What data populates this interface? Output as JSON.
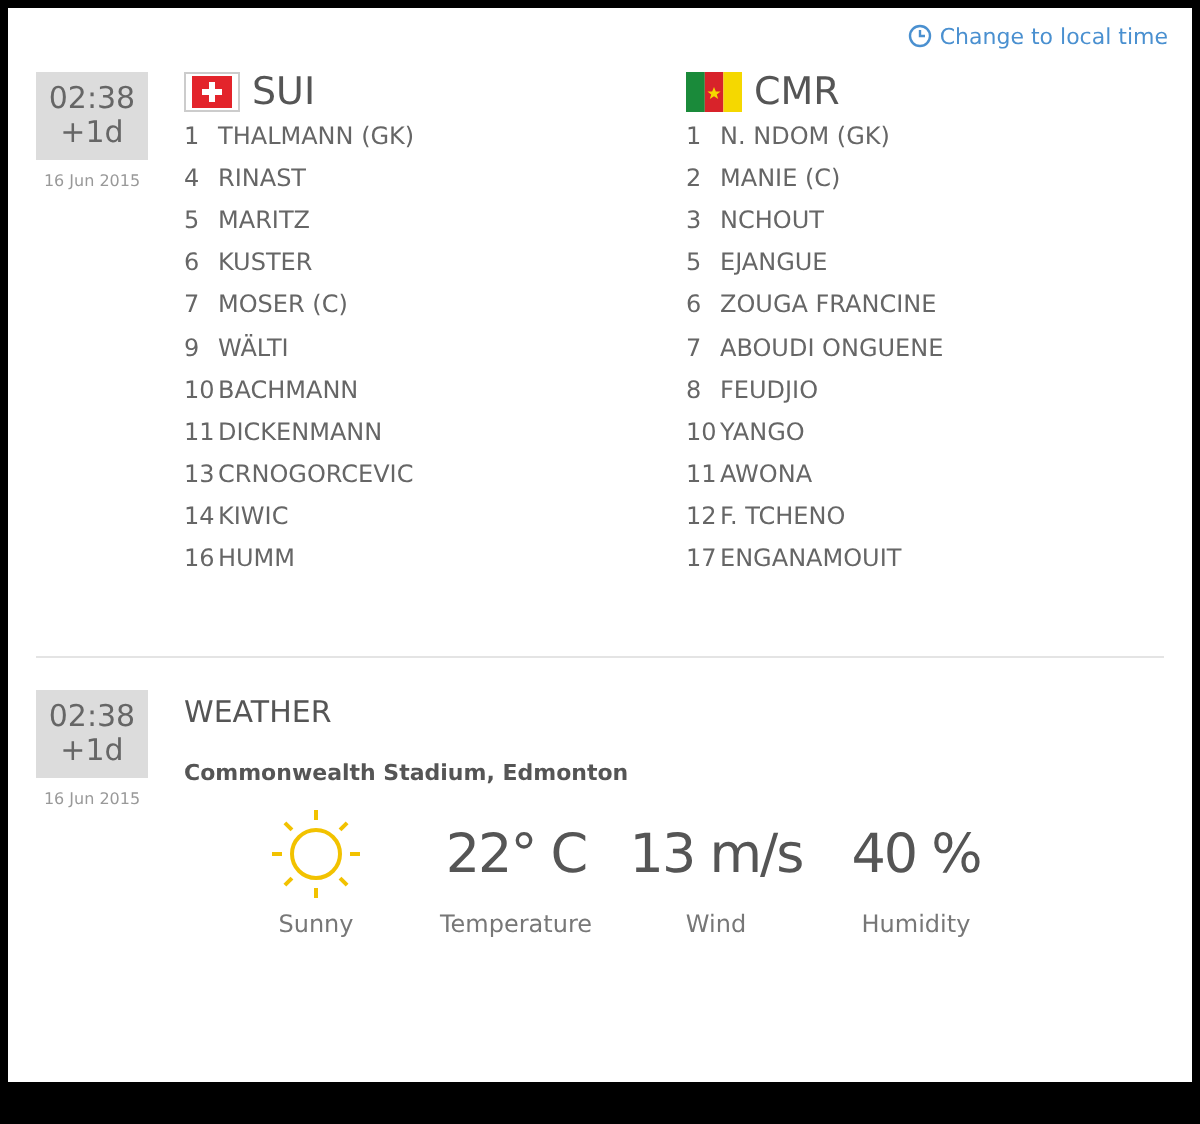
{
  "local_time_link": "Change to local time",
  "lineups": {
    "kickoff": {
      "time": "02:38",
      "day_offset": "+1d",
      "date": "16 Jun 2015"
    },
    "teams": [
      {
        "code": "SUI",
        "players": [
          {
            "number": "1",
            "name": "THALMANN (GK)"
          },
          {
            "number": "4",
            "name": "RINAST"
          },
          {
            "number": "5",
            "name": "MARITZ"
          },
          {
            "number": "6",
            "name": "KUSTER"
          },
          {
            "number": "7",
            "name": "MOSER (C)"
          },
          {
            "number": "9",
            "name": "WÄLTI"
          },
          {
            "number": "10",
            "name": "BACHMANN"
          },
          {
            "number": "11",
            "name": "DICKENMANN"
          },
          {
            "number": "13",
            "name": "CRNOGORCEVIC"
          },
          {
            "number": "14",
            "name": "KIWIC"
          },
          {
            "number": "16",
            "name": "HUMM"
          }
        ]
      },
      {
        "code": "CMR",
        "players": [
          {
            "number": "1",
            "name": "N. NDOM (GK)"
          },
          {
            "number": "2",
            "name": "MANIE (C)"
          },
          {
            "number": "3",
            "name": "NCHOUT"
          },
          {
            "number": "5",
            "name": "EJANGUE"
          },
          {
            "number": "6",
            "name": "ZOUGA FRANCINE"
          },
          {
            "number": "7",
            "name": "ABOUDI ONGUENE"
          },
          {
            "number": "8",
            "name": "FEUDJIO"
          },
          {
            "number": "10",
            "name": "YANGO"
          },
          {
            "number": "11",
            "name": "AWONA"
          },
          {
            "number": "12",
            "name": "F. TCHENO"
          },
          {
            "number": "17",
            "name": "ENGANAMOUIT"
          }
        ]
      }
    ]
  },
  "weather": {
    "kickoff": {
      "time": "02:38",
      "day_offset": "+1d",
      "date": "16 Jun 2015"
    },
    "title": "WEATHER",
    "venue": "Commonwealth Stadium, Edmonton",
    "stats": [
      {
        "kind": "icon",
        "label": "Sunny"
      },
      {
        "kind": "value",
        "value": "22° C",
        "label": "Temperature"
      },
      {
        "kind": "value",
        "value": "13 m/s",
        "label": "Wind"
      },
      {
        "kind": "value",
        "value": "40 %",
        "label": "Humidity"
      }
    ]
  }
}
